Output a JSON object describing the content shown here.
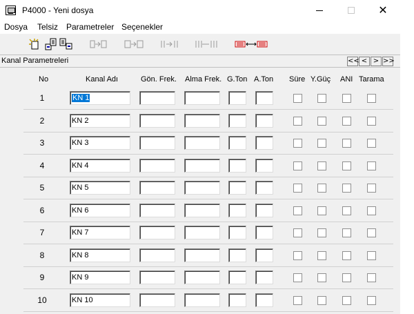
{
  "window": {
    "title": "P4000 - Yeni dosya"
  },
  "menu": {
    "items": [
      "Dosya",
      "Telsiz",
      "Parametreler",
      "Seçenekler"
    ]
  },
  "toolbar": {
    "buttons": [
      "new-file-icon",
      "open-file-icon",
      "save-file-icon",
      "copy-right-icon",
      "copy-right-alt-icon",
      "copy-channel-icon",
      "copy-range-icon",
      "transfer-both-icon"
    ]
  },
  "panel": {
    "title": "Kanal Parametreleri",
    "nav": [
      "<<",
      "<",
      ">",
      ">>"
    ]
  },
  "columns": [
    "No",
    "Kanal Adı",
    "Gön. Frek.",
    "Alma Frek.",
    "G.Ton",
    "A.Ton",
    "Süre",
    "Y.Güç",
    "ANI",
    "Tarama"
  ],
  "rows": [
    {
      "no": "1",
      "name": "KN 1",
      "tx_freq": "",
      "rx_freq": "",
      "g_ton": "",
      "a_ton": ""
    },
    {
      "no": "2",
      "name": "KN 2",
      "tx_freq": "",
      "rx_freq": "",
      "g_ton": "",
      "a_ton": ""
    },
    {
      "no": "3",
      "name": "KN 3",
      "tx_freq": "",
      "rx_freq": "",
      "g_ton": "",
      "a_ton": ""
    },
    {
      "no": "4",
      "name": "KN 4",
      "tx_freq": "",
      "rx_freq": "",
      "g_ton": "",
      "a_ton": ""
    },
    {
      "no": "5",
      "name": "KN 5",
      "tx_freq": "",
      "rx_freq": "",
      "g_ton": "",
      "a_ton": ""
    },
    {
      "no": "6",
      "name": "KN 6",
      "tx_freq": "",
      "rx_freq": "",
      "g_ton": "",
      "a_ton": ""
    },
    {
      "no": "7",
      "name": "KN 7",
      "tx_freq": "",
      "rx_freq": "",
      "g_ton": "",
      "a_ton": ""
    },
    {
      "no": "8",
      "name": "KN 8",
      "tx_freq": "",
      "rx_freq": "",
      "g_ton": "",
      "a_ton": ""
    },
    {
      "no": "9",
      "name": "KN 9",
      "tx_freq": "",
      "rx_freq": "",
      "g_ton": "",
      "a_ton": ""
    },
    {
      "no": "10",
      "name": "KN 10",
      "tx_freq": "",
      "rx_freq": "",
      "g_ton": "",
      "a_ton": ""
    }
  ],
  "selected_row": 0,
  "colors": {
    "selection": "#0078d7",
    "window_bg": "#f0f0f0",
    "toolbar_arrow": "#cc0000"
  }
}
